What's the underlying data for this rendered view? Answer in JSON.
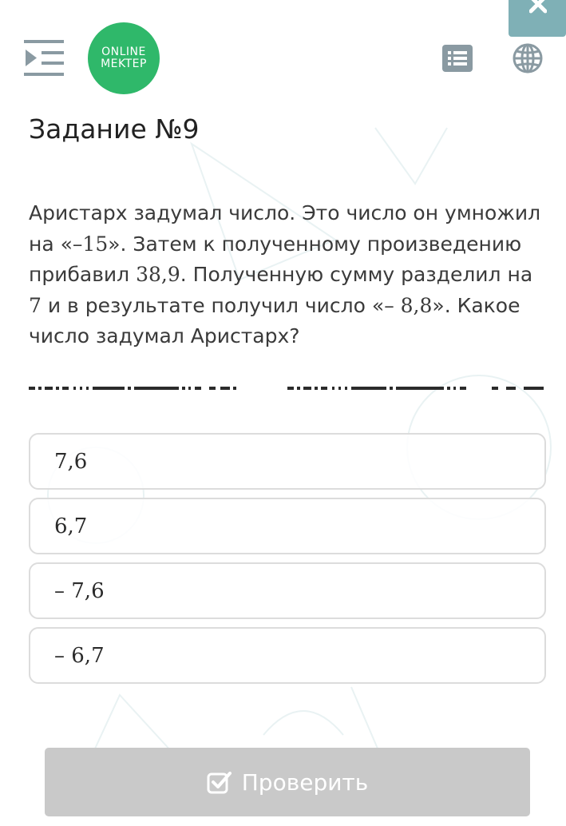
{
  "header": {
    "logo": {
      "line1": "ONLINE",
      "line2": "MEKTEP",
      "color": "#2fb86a"
    },
    "icons": [
      "menu-indent-icon",
      "list-icon",
      "globe-icon",
      "close-icon"
    ]
  },
  "task": {
    "title": "Задание №9",
    "question": {
      "p1": "Аристарх задумал число. Это число он умножил на «",
      "n1": "–15",
      "p2": "». Затем к полученному произведению прибавил ",
      "n2": "38,9",
      "p3": ". Полученную сумму разделил на ",
      "n3": "7",
      "p4": " и в результате получил число «",
      "n4": "– 8,8",
      "p5": "». Какое число задумал Аристарх?"
    }
  },
  "options": [
    {
      "label": "7,6"
    },
    {
      "label": "6,7"
    },
    {
      "label": "– 7,6"
    },
    {
      "label": "– 6,7"
    }
  ],
  "check_button": {
    "label": "Проверить",
    "icon": "checkbox-icon"
  },
  "colors": {
    "accent": "#2fb86a",
    "close_bg": "#7fb0b6",
    "icon_gray": "#8a9aa2",
    "button_disabled": "#c9c9c9"
  }
}
